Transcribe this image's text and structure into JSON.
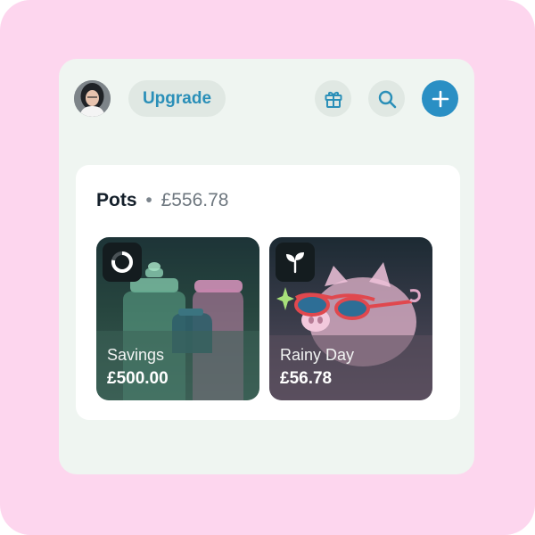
{
  "header": {
    "upgrade_label": "Upgrade",
    "icons": [
      "avatar",
      "gift-icon",
      "search-icon",
      "plus-icon"
    ]
  },
  "pots": {
    "title": "Pots",
    "separator": "•",
    "total": "£556.78",
    "items": [
      {
        "name": "Savings",
        "amount": "£500.00",
        "icon": "progress-ring-icon",
        "progress": 0.78
      },
      {
        "name": "Rainy Day",
        "amount": "£56.78",
        "icon": "sprout-icon"
      }
    ]
  },
  "colors": {
    "frame_bg": "#fdd6ee",
    "app_bg": "#eff5f1",
    "accent": "#2a8fc4",
    "upgrade_text": "#2a8fb8"
  }
}
